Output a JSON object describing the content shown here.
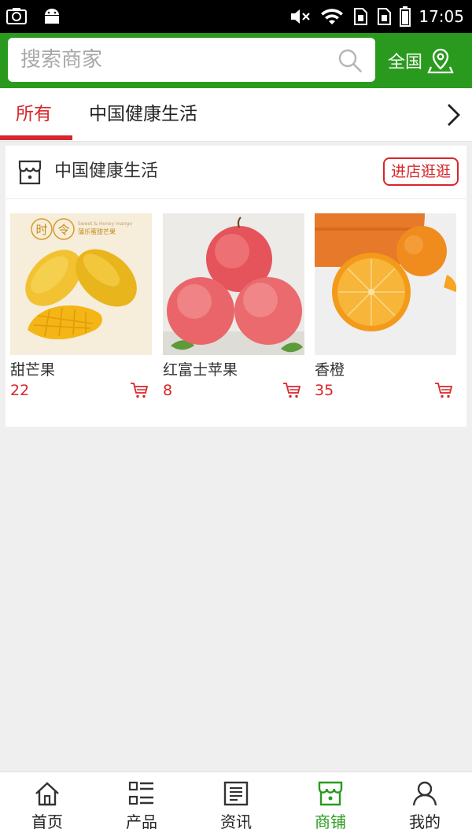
{
  "status_bar": {
    "time": "17:05"
  },
  "search": {
    "placeholder": "搜索商家"
  },
  "region": {
    "label": "全国"
  },
  "tabs": [
    {
      "label": "所有",
      "active": true
    },
    {
      "label": "中国健康生活",
      "active": false
    }
  ],
  "store": {
    "name": "中国健康生活",
    "visit_label": "进店逛逛",
    "products": [
      {
        "name": "甜芒果",
        "price": "22",
        "image": "mango",
        "image_text_main": "时令",
        "image_text_sub": "Sweet & Honey mango",
        "image_text_cn": "蒲乐蜜甜芒果"
      },
      {
        "name": "红富士苹果",
        "price": "8",
        "image": "apples"
      },
      {
        "name": "香橙",
        "price": "35",
        "image": "oranges"
      }
    ]
  },
  "bottom_nav": [
    {
      "label": "首页",
      "icon": "home-icon",
      "active": false
    },
    {
      "label": "产品",
      "icon": "list-icon",
      "active": false
    },
    {
      "label": "资讯",
      "icon": "news-icon",
      "active": false
    },
    {
      "label": "商铺",
      "icon": "shop-icon",
      "active": true
    },
    {
      "label": "我的",
      "icon": "user-icon",
      "active": false
    }
  ],
  "colors": {
    "brand_green": "#2a9a1e",
    "accent_red": "#d8262a"
  }
}
